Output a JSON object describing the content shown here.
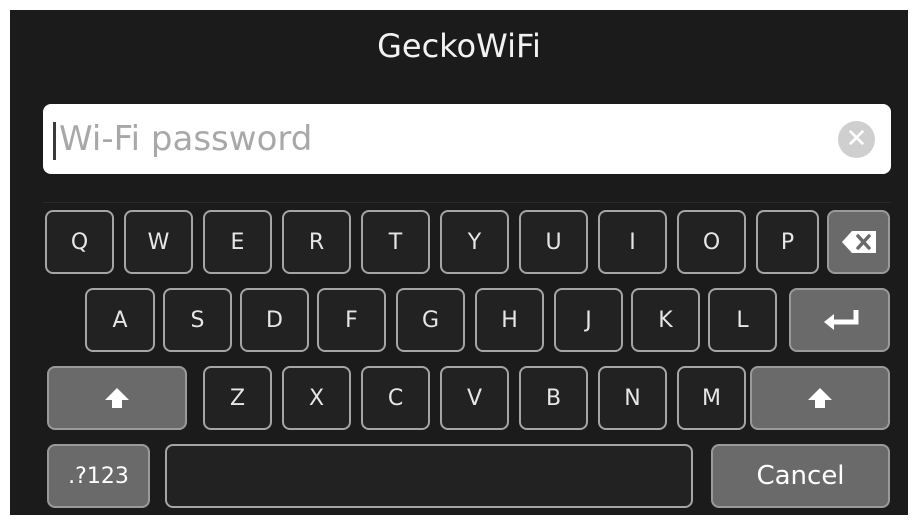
{
  "title": "GeckoWiFi",
  "password_field": {
    "placeholder": "Wi-Fi password",
    "value": ""
  },
  "keyboard": {
    "row1": [
      "Q",
      "W",
      "E",
      "R",
      "T",
      "Y",
      "U",
      "I",
      "O",
      "P"
    ],
    "row2": [
      "A",
      "S",
      "D",
      "F",
      "G",
      "H",
      "J",
      "K",
      "L"
    ],
    "row3": [
      "Z",
      "X",
      "C",
      "V",
      "B",
      "N",
      "M"
    ],
    "numbers_label": ".?123",
    "cancel_label": "Cancel",
    "icons": {
      "backspace": "backspace-icon",
      "enter": "enter-icon",
      "shift": "shift-icon",
      "clear": "clear-icon"
    }
  },
  "colors": {
    "background": "#1b1b1b",
    "key_border": "#a5a5a5",
    "special_key": "#6a6a6a",
    "field": "#ffffff"
  }
}
